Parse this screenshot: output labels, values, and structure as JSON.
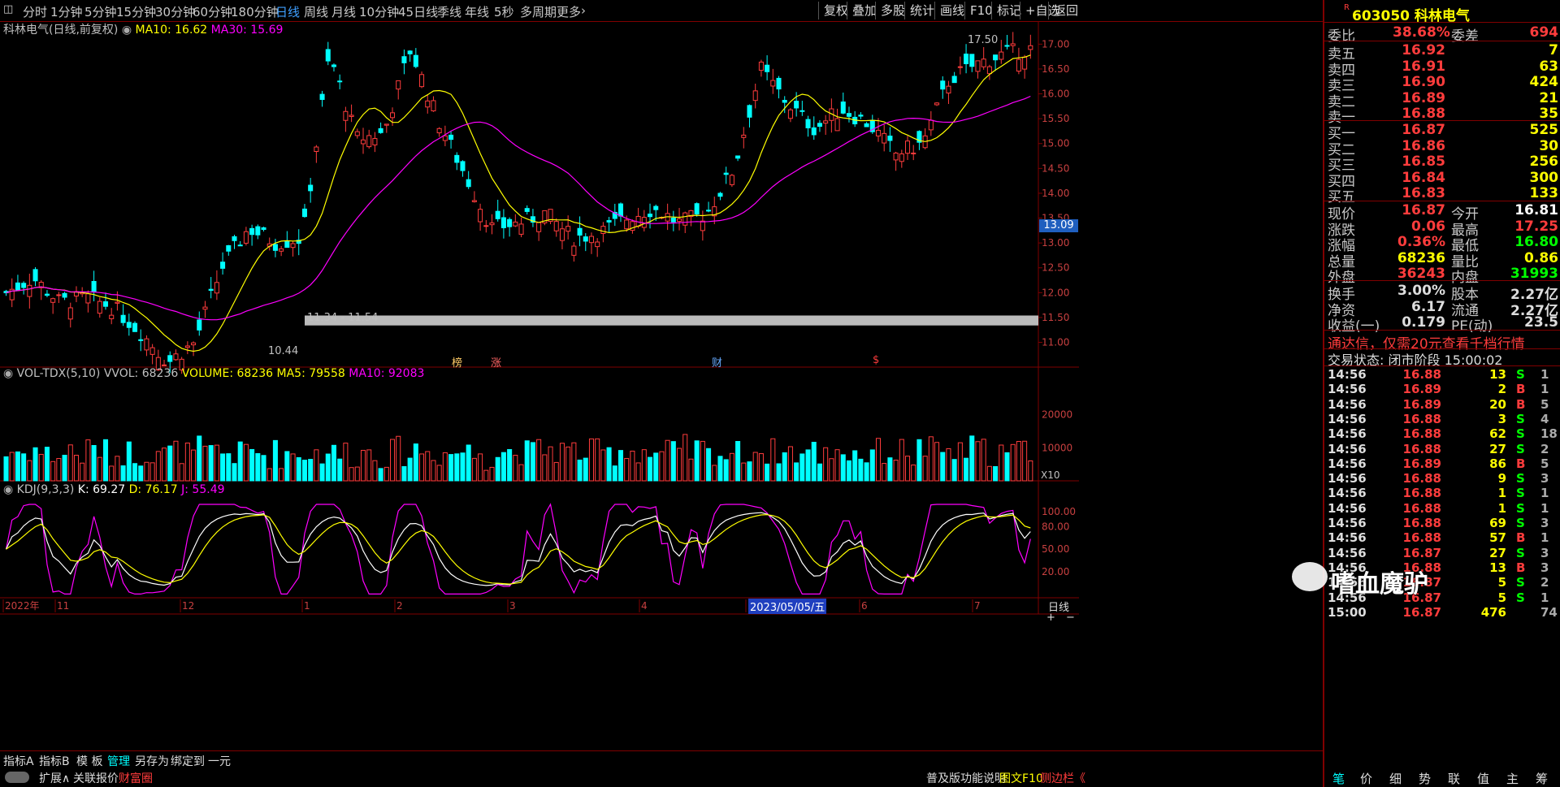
{
  "toolbar": {
    "periods": [
      "分时",
      "1分钟",
      "5分钟",
      "15分钟",
      "30分钟",
      "60分钟",
      "180分钟",
      "日线",
      "周线",
      "月线",
      "10分钟",
      "45日线",
      "季线",
      "年线",
      "5秒",
      "多周期",
      "更多"
    ],
    "active_period": "日线",
    "right_buttons": [
      "复权",
      "叠加",
      "多股",
      "统计",
      "画线",
      "F10",
      "标记",
      "+自选",
      "返回"
    ]
  },
  "stock": {
    "code": "603050",
    "name": "科林电气",
    "badge": "R"
  },
  "main_chart": {
    "title": "科林电气(日线,前复权)",
    "ma10_label": "MA10: 16.62",
    "ma30_label": "MA30: 15.69",
    "price_high_label": "17.50",
    "price_low_label": "10.44",
    "zone_label": "11.34 - 11.54",
    "cursor_price": "13.09",
    "markers": [
      "榜",
      "涨",
      "财",
      "$"
    ]
  },
  "volume_chart": {
    "title": "VOL-TDX(5,10)",
    "vvol": "VVOL: 68236",
    "volume": "VOLUME: 68236",
    "ma5": "MA5: 79558",
    "ma10": "MA10: 92083",
    "unit": "X10"
  },
  "kdj_chart": {
    "title": "KDJ(9,3,3)",
    "k": "K: 69.27",
    "d": "D: 76.17",
    "j": "J: 55.49"
  },
  "chart_data": [
    {
      "type": "candlestick",
      "title": "科林电气(日线,前复权)",
      "y_ticks": [
        "17.00",
        "16.50",
        "16.00",
        "15.50",
        "15.00",
        "14.50",
        "14.00",
        "13.50",
        "13.00",
        "12.50",
        "12.00",
        "11.50",
        "11.00"
      ],
      "ylim": [
        10.44,
        17.5
      ],
      "x_ticks": [
        "2022年",
        "11",
        "12",
        "1",
        "2",
        "3",
        "4",
        "5",
        "6",
        "7"
      ],
      "series": [
        {
          "name": "MA10",
          "last": 16.62
        },
        {
          "name": "MA30",
          "last": 15.69
        }
      ]
    },
    {
      "type": "bar",
      "title": "VOL-TDX(5,10)",
      "y_ticks": [
        "20000",
        "10000"
      ],
      "series": [
        {
          "name": "VOLUME",
          "last": 68236
        },
        {
          "name": "MA5",
          "last": 79558
        },
        {
          "name": "MA10",
          "last": 92083
        }
      ]
    },
    {
      "type": "line",
      "title": "KDJ(9,3,3)",
      "y_ticks": [
        "100.00",
        "80.00",
        "50.00",
        "20.00"
      ],
      "series": [
        {
          "name": "K",
          "last": 69.27
        },
        {
          "name": "D",
          "last": 76.17
        },
        {
          "name": "J",
          "last": 55.49
        }
      ]
    }
  ],
  "x_axis": {
    "date_label": "2023/05/05/五",
    "period_label": "日线"
  },
  "quote": {
    "weibi_label": "委比",
    "weibi": "38.68%",
    "weicha_label": "委差",
    "weicha": "694",
    "asks": [
      {
        "label": "卖五",
        "price": "16.92",
        "vol": "7"
      },
      {
        "label": "卖四",
        "price": "16.91",
        "vol": "63"
      },
      {
        "label": "卖三",
        "price": "16.90",
        "vol": "424"
      },
      {
        "label": "卖二",
        "price": "16.89",
        "vol": "21"
      },
      {
        "label": "卖一",
        "price": "16.88",
        "vol": "35"
      }
    ],
    "bids": [
      {
        "label": "买一",
        "price": "16.87",
        "vol": "525"
      },
      {
        "label": "买二",
        "price": "16.86",
        "vol": "30"
      },
      {
        "label": "买三",
        "price": "16.85",
        "vol": "256"
      },
      {
        "label": "买四",
        "price": "16.84",
        "vol": "300"
      },
      {
        "label": "买五",
        "price": "16.83",
        "vol": "133"
      }
    ],
    "stats": [
      {
        "l1": "现价",
        "v1": "16.87",
        "l2": "今开",
        "v2": "16.81"
      },
      {
        "l1": "涨跌",
        "v1": "0.06",
        "l2": "最高",
        "v2": "17.25"
      },
      {
        "l1": "涨幅",
        "v1": "0.36%",
        "l2": "最低",
        "v2": "16.80"
      },
      {
        "l1": "总量",
        "v1": "68236",
        "l2": "量比",
        "v2": "0.86"
      },
      {
        "l1": "外盘",
        "v1": "36243",
        "l2": "内盘",
        "v2": "31993"
      }
    ],
    "stats2": [
      {
        "l1": "换手",
        "v1": "3.00%",
        "l2": "股本",
        "v2": "2.27亿"
      },
      {
        "l1": "净资",
        "v1": "6.17",
        "l2": "流通",
        "v2": "2.27亿"
      },
      {
        "l1": "收益(一)",
        "v1": "0.179",
        "l2": "PE(动)",
        "v2": "23.5"
      }
    ],
    "promo": "通达信，仅需20元查看千档行情",
    "status_label": "交易状态:",
    "status": "闭市阶段 15:00:02",
    "ticks": [
      {
        "t": "14:56",
        "p": "16.88",
        "v": "13",
        "s": "S",
        "n": "1"
      },
      {
        "t": "14:56",
        "p": "16.89",
        "v": "2",
        "s": "B",
        "n": "1"
      },
      {
        "t": "14:56",
        "p": "16.89",
        "v": "20",
        "s": "B",
        "n": "5"
      },
      {
        "t": "14:56",
        "p": "16.88",
        "v": "3",
        "s": "S",
        "n": "4"
      },
      {
        "t": "14:56",
        "p": "16.88",
        "v": "62",
        "s": "S",
        "n": "18"
      },
      {
        "t": "14:56",
        "p": "16.88",
        "v": "27",
        "s": "S",
        "n": "2"
      },
      {
        "t": "14:56",
        "p": "16.89",
        "v": "86",
        "s": "B",
        "n": "5"
      },
      {
        "t": "14:56",
        "p": "16.88",
        "v": "9",
        "s": "S",
        "n": "3"
      },
      {
        "t": "14:56",
        "p": "16.88",
        "v": "1",
        "s": "S",
        "n": "1"
      },
      {
        "t": "14:56",
        "p": "16.88",
        "v": "1",
        "s": "S",
        "n": "1"
      },
      {
        "t": "14:56",
        "p": "16.88",
        "v": "69",
        "s": "S",
        "n": "3"
      },
      {
        "t": "14:56",
        "p": "16.88",
        "v": "57",
        "s": "B",
        "n": "1"
      },
      {
        "t": "14:56",
        "p": "16.87",
        "v": "27",
        "s": "S",
        "n": "3"
      },
      {
        "t": "14:56",
        "p": "16.88",
        "v": "13",
        "s": "B",
        "n": "3"
      },
      {
        "t": "14:56",
        "p": "16.87",
        "v": "5",
        "s": "S",
        "n": "2"
      },
      {
        "t": "14:56",
        "p": "16.87",
        "v": "5",
        "s": "S",
        "n": "1"
      },
      {
        "t": "15:00",
        "p": "16.87",
        "v": "476",
        "s": "",
        "n": "74"
      }
    ],
    "watermark": "嗜血魔驴"
  },
  "bottom": {
    "tabs1": [
      "指标A",
      "指标B",
      "模 板",
      "管理",
      "另存为",
      "绑定到",
      "一元"
    ],
    "tabs2": [
      "扩展∧",
      "关联报价",
      "财富圈"
    ],
    "right_links": [
      "普及版功能说明",
      "图文F10",
      "侧边栏《"
    ],
    "right_tabs": [
      "笔",
      "价",
      "细",
      "势",
      "联",
      "值",
      "主",
      "筹"
    ]
  },
  "colors": {
    "up": "#ff3c3c",
    "down": "#00ffff",
    "ma10": "#ffff00",
    "ma30": "#ff00ff",
    "k": "#ffffff",
    "d": "#ffff00",
    "j": "#ff00ff"
  }
}
